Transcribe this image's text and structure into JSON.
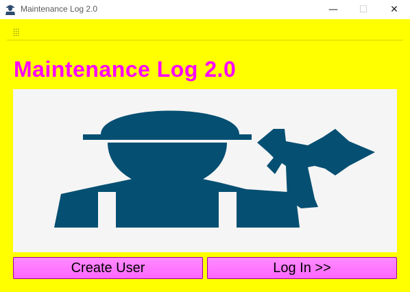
{
  "window": {
    "title": "Maintenance Log 2.0",
    "controls": {
      "minimize": "—",
      "maximize": "☐",
      "close": "✕"
    }
  },
  "main": {
    "heading": "Maintenance Log 2.0",
    "logo_icon": "worker-with-wrench-icon",
    "buttons": {
      "create_user": "Create User",
      "log_in": "Log In >>"
    }
  },
  "colors": {
    "background": "#ffff00",
    "heading": "#ff00ff",
    "button": "#ff77ff",
    "logo": "#054f72"
  }
}
